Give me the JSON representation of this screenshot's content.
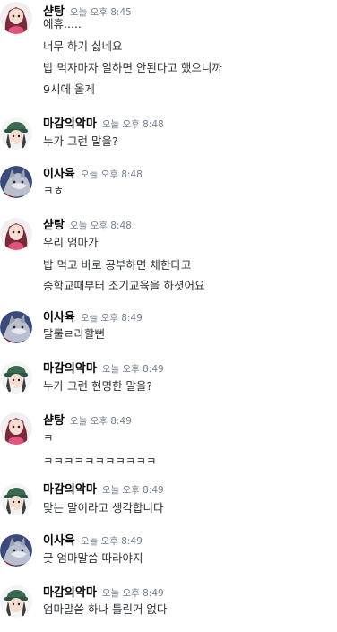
{
  "users": {
    "satang": {
      "name": "샫탕",
      "avatar": "pink-haired-girl-avatar"
    },
    "magam": {
      "name": "마감의악마",
      "avatar": "green-cap-character-avatar"
    },
    "isayuk": {
      "name": "이사육",
      "avatar": "wolf-avatar"
    }
  },
  "messages": [
    {
      "user": "satang",
      "time": "오늘 오후 8:45",
      "lines": [
        "에휴.....",
        "너무 하기 싫네요",
        "밥 먹자마자 일하면 안된다고 했으니까",
        "9시에 올게"
      ]
    },
    {
      "user": "magam",
      "time": "오늘 오후 8:48",
      "lines": [
        "누가 그런 말을?"
      ]
    },
    {
      "user": "isayuk",
      "time": "오늘 오후 8:48",
      "lines": [
        "ㅋㅎ"
      ]
    },
    {
      "user": "satang",
      "time": "오늘 오후 8:48",
      "lines": [
        "우리 엄마가",
        "밥 먹고 바로 공부하면 체한다고",
        "중학교때부터 조기교육을 하셧어요"
      ]
    },
    {
      "user": "isayuk",
      "time": "오늘 오후 8:49",
      "lines": [
        "탈룰ㄹ라할뻔"
      ]
    },
    {
      "user": "magam",
      "time": "오늘 오후 8:49",
      "lines": [
        "누가 그런 현명한 말을?"
      ]
    },
    {
      "user": "satang",
      "time": "오늘 오후 8:49",
      "lines": [
        "ㅋ",
        "ㅋㅋㅋㅋㅋㅋㅋㅋㅋㅋㅋ"
      ]
    },
    {
      "user": "magam",
      "time": "오늘 오후 8:49",
      "lines": [
        "맞는 말이라고 생각합니다"
      ]
    },
    {
      "user": "isayuk",
      "time": "오늘 오후 8:49",
      "lines": [
        "굿 엄마말씀 따라야지"
      ]
    },
    {
      "user": "magam",
      "time": "오늘 오후 8:49",
      "lines": [
        "엄마말씀 하나 틀린거 없다"
      ]
    }
  ]
}
